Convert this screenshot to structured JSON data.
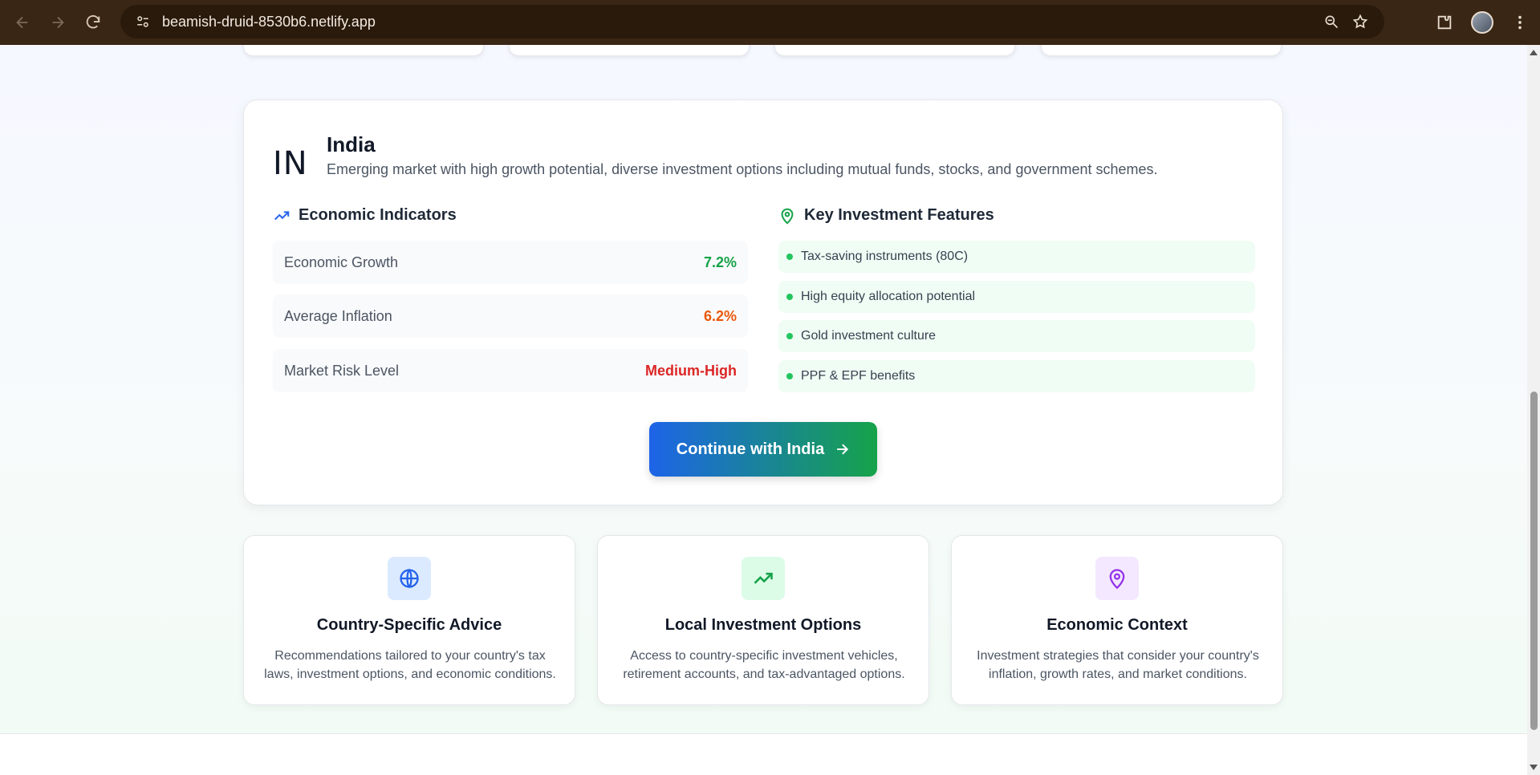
{
  "browser": {
    "url": "beamish-druid-8530b6.netlify.app"
  },
  "country": {
    "code": "IN",
    "name": "India",
    "description": "Emerging market with high growth potential, diverse investment options including mutual funds, stocks, and government schemes."
  },
  "indicators": {
    "title": "Economic Indicators",
    "rows": [
      {
        "label": "Economic Growth",
        "value": "7.2%",
        "color": "#16a34a"
      },
      {
        "label": "Average Inflation",
        "value": "6.2%",
        "color": "#ea580c"
      },
      {
        "label": "Market Risk Level",
        "value": "Medium-High",
        "color": "#dc2626"
      }
    ]
  },
  "features": {
    "title": "Key Investment Features",
    "items": [
      "Tax-saving instruments (80C)",
      "High equity allocation potential",
      "Gold investment culture",
      "PPF & EPF benefits"
    ]
  },
  "continue_button": {
    "label": "Continue with India"
  },
  "info_cards": [
    {
      "icon": "globe-icon",
      "title": "Country-Specific Advice",
      "line1": "Recommendations tailored to your country's tax",
      "line2": "laws, investment options, and economic conditions.",
      "icon_bg": "#dbeafe",
      "icon_color": "#2563eb"
    },
    {
      "icon": "trending-up-icon",
      "title": "Local Investment Options",
      "line1": "Access to country-specific investment vehicles,",
      "line2": "retirement accounts, and tax-advantaged options.",
      "icon_bg": "#dcfce7",
      "icon_color": "#16a34a"
    },
    {
      "icon": "map-pin-icon",
      "title": "Economic Context",
      "line1": "Investment strategies that consider your country's",
      "line2": "inflation, growth rates, and market conditions.",
      "icon_bg": "#f3e8ff",
      "icon_color": "#9333ea"
    }
  ]
}
